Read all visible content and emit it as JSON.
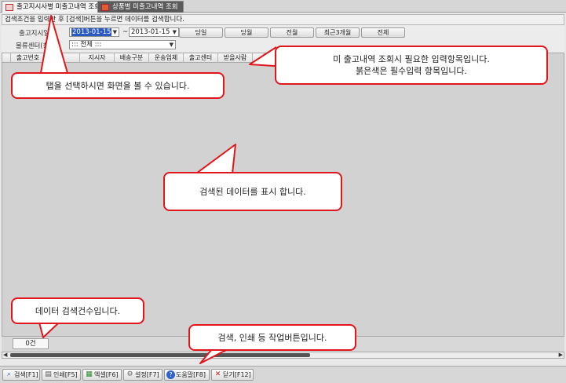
{
  "tabs": [
    {
      "label": "출고지시사별 미출고내역 조회",
      "active": true
    },
    {
      "label": "상품별 미출고내역 조회",
      "active": false
    }
  ],
  "guide_text": "검색조건을 입력한 후 [검색]버튼을 누르면 데이터를 검색합니다.",
  "search": {
    "date_label": "출고지시일",
    "date_from": "2013-01-15",
    "tilde": "~",
    "date_to": "2013-01-15",
    "center_label": "물류센터(창",
    "center_value": "::: 전체 :::",
    "period_buttons": [
      "당일",
      "당월",
      "전월",
      "최근3개월",
      "전체"
    ]
  },
  "grid": {
    "columns": [
      "출고번호",
      "",
      "지시자",
      "배송구분",
      "운송업체",
      "출고센터",
      "받을사람"
    ],
    "count": "0건"
  },
  "actions": [
    {
      "label": "검색[F1]",
      "icon": "search-icon"
    },
    {
      "label": "인쇄[F5]",
      "icon": "print-icon"
    },
    {
      "label": "엑셀[F6]",
      "icon": "excel-icon"
    },
    {
      "label": "설정[F7]",
      "icon": "gear-icon"
    },
    {
      "label": "도움말[F8]",
      "icon": "help-icon"
    },
    {
      "label": "닫기[F12]",
      "icon": "close-icon"
    }
  ],
  "callouts": {
    "tab_help": "탭을 선택하시면 화면을 볼 수 있습니다.",
    "input_help_line1": "미 출고내역 조회시 필요한 입력항목입니다.",
    "input_help_line2": "붉은색은 필수입력 항목입니다.",
    "grid_help": "검색된 데이터를 표시 합니다.",
    "count_help": "데이터 검색건수입니다.",
    "button_help": "검색, 인쇄 등 작업버튼입니다."
  },
  "colors": {
    "callout_border": "#e0161b",
    "selection": "#2b59c3"
  }
}
